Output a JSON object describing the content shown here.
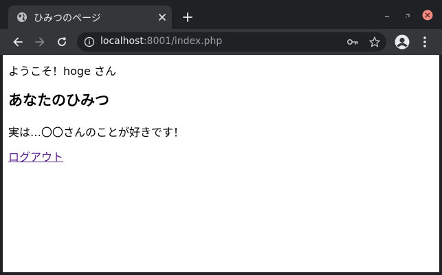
{
  "browser": {
    "tab": {
      "title": "ひみつのページ",
      "favicon": "globe-icon"
    },
    "address_bar": {
      "host": "localhost",
      "path": ":8001/index.php"
    },
    "colors": {
      "frame": "#202124",
      "toolbar": "#35363a",
      "close_button": "#f28b82"
    }
  },
  "page": {
    "greeting": "ようこそ！hoge さん",
    "heading": "あなたのひみつ",
    "secret": "実は…〇〇さんのことが好きです！",
    "logout_link": "ログアウト",
    "link_color": "#551a8b"
  }
}
